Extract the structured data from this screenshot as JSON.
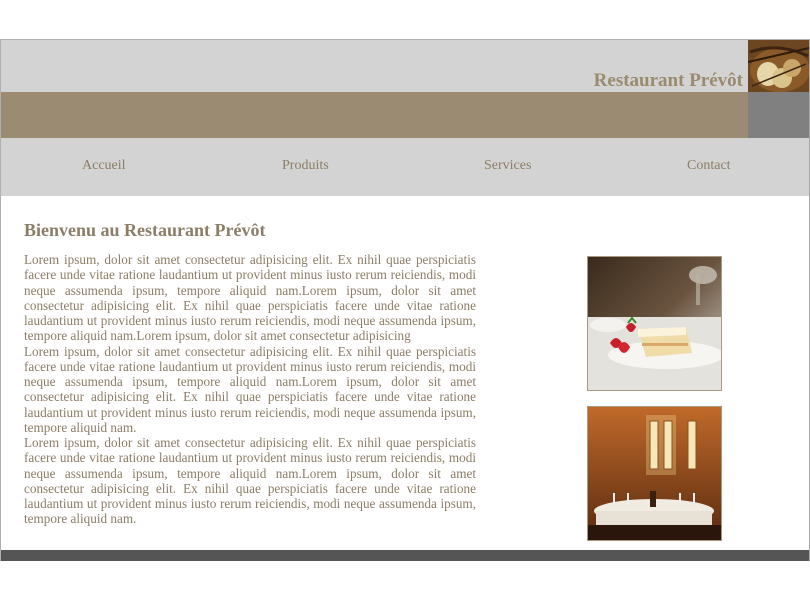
{
  "header": {
    "title": "Restaurant Prévôt"
  },
  "nav": {
    "items": [
      "Accueil",
      "Produits",
      "Services",
      "Contact"
    ]
  },
  "main": {
    "heading": "Bienvenu au Restaurant Prévôt",
    "paragraphs": [
      "Lorem ipsum, dolor sit amet consectetur adipisicing elit. Ex nihil quae perspiciatis facere unde vitae ratione laudantium ut provident minus iusto rerum reiciendis, modi neque assumenda ipsum, tempore aliquid nam.Lorem ipsum, dolor sit amet consectetur adipisicing elit. Ex nihil quae perspiciatis facere unde vitae ratione laudantium ut provident minus iusto rerum reiciendis, modi neque assumenda ipsum, tempore aliquid nam.Lorem ipsum, dolor sit amet consectetur adipisicing",
      "Lorem ipsum, dolor sit amet consectetur adipisicing elit. Ex nihil quae perspiciatis facere unde vitae ratione laudantium ut provident minus iusto rerum reiciendis, modi neque assumenda ipsum, tempore aliquid nam.Lorem ipsum, dolor sit amet consectetur adipisicing elit. Ex nihil quae perspiciatis facere unde vitae ratione laudantium ut provident minus iusto rerum reiciendis, modi neque assumenda ipsum, tempore aliquid nam.",
      "Lorem ipsum, dolor sit amet consectetur adipisicing elit. Ex nihil quae perspiciatis facere unde vitae ratione laudantium ut provident minus iusto rerum reiciendis, modi neque assumenda ipsum, tempore aliquid nam.Lorem ipsum, dolor sit amet consectetur adipisicing elit. Ex nihil quae perspiciatis facere unde vitae ratione laudantium ut provident minus iusto rerum reiciendis, modi neque assumenda ipsum, tempore aliquid nam."
    ]
  },
  "images": {
    "logo": "bread-basket-photo",
    "photo_1": "strawberry-cake-dessert-photo",
    "photo_2": "dining-room-table-photo"
  },
  "colors": {
    "accent": "#9a8b72",
    "text": "#8b7d66",
    "light_gray": "#d3d3d3",
    "dark_gray": "#808080",
    "footer": "#555555"
  }
}
